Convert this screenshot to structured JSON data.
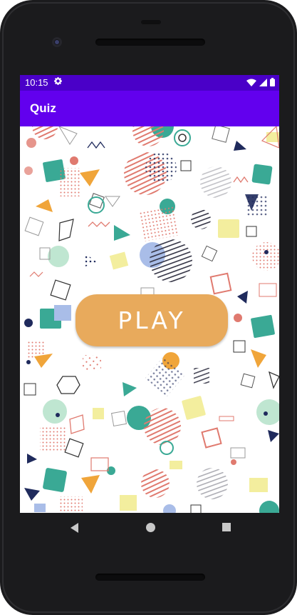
{
  "status_bar": {
    "time": "10:15",
    "settings_icon": "gear-icon",
    "wifi_icon": "wifi-icon",
    "signal_icon": "cell-signal-icon",
    "battery_icon": "battery-icon"
  },
  "app_bar": {
    "title": "Quiz"
  },
  "main": {
    "play_label": "PLAY"
  },
  "nav": {
    "back_icon": "back-triangle-icon",
    "home_icon": "home-circle-icon",
    "recents_icon": "recents-square-icon"
  },
  "colors": {
    "status_bar": "#4a00c8",
    "app_bar": "#6200ee",
    "play_button": "#e8aa5c",
    "pattern_teal": "#3aa995",
    "pattern_orange": "#f0a53a",
    "pattern_navy": "#1f2a5c",
    "pattern_coral": "#e07a6f",
    "pattern_yellow": "#f3ee9e",
    "pattern_mint": "#bfe6d1",
    "pattern_periwinkle": "#a9bde8"
  }
}
